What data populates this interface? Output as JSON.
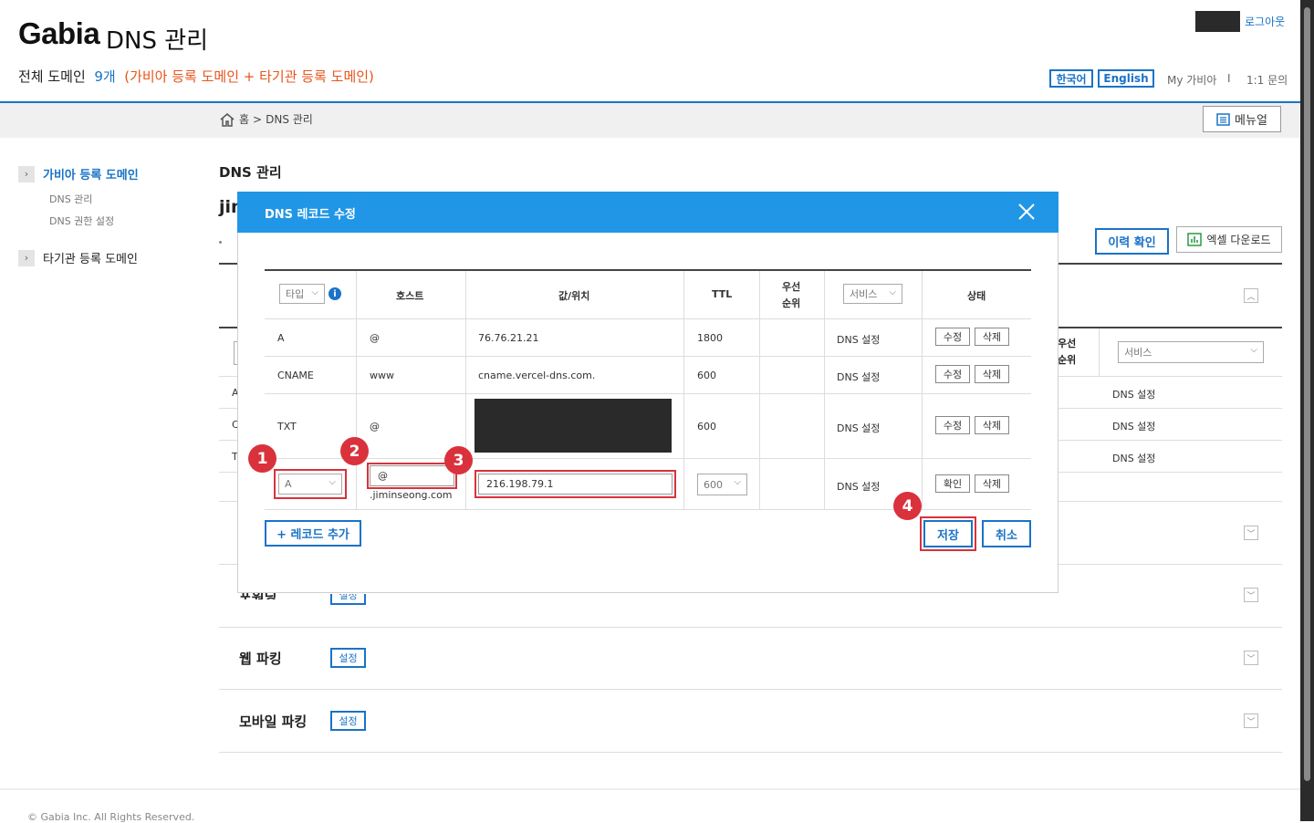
{
  "header": {
    "brand": "Gabia",
    "brand_sub": "DNS 관리",
    "domain_label": "전체 도메인",
    "domain_count": "9개",
    "domain_desc": "(가비아 등록 도메인 + 타기관 등록 도메인)",
    "logout": "로그아웃",
    "lang_ko": "한국어",
    "lang_en": "English",
    "my_gabia": "My 가비아",
    "separator": "I",
    "inquiry": "1:1 문의"
  },
  "breadcrumb": {
    "home": "홈",
    "sep": ">",
    "current": "DNS 관리"
  },
  "manual": "메뉴얼",
  "sidebar": {
    "group1": "가비아 등록 도메인",
    "items": [
      "DNS 관리",
      "DNS 권한 설정"
    ],
    "group2": "타기관 등록 도메인"
  },
  "main": {
    "title": "DNS 관리",
    "domain_partial": "jim",
    "history_btn": "이력 확인",
    "excel_btn": "엑셀 다운로드",
    "bg_priority": "우선\n순위",
    "bg_service": "서비스",
    "bg_rows": [
      "DNS 설정",
      "DNS 설정",
      "DNS 설정"
    ],
    "bg_types": [
      "A",
      "C",
      "T"
    ],
    "sections": [
      {
        "title": "포워딩",
        "btn": "설정"
      },
      {
        "title": "웹 파킹",
        "btn": "설정"
      },
      {
        "title": "모바일 파킹",
        "btn": "설정"
      }
    ]
  },
  "modal": {
    "title": "DNS 레코드 수정",
    "headers": {
      "type": "타입",
      "host": "호스트",
      "value": "값/위치",
      "ttl": "TTL",
      "priority": "우선\n순위",
      "service": "서비스",
      "status": "상태"
    },
    "rows": [
      {
        "type": "A",
        "host": "@",
        "value": "76.76.21.21",
        "ttl": "1800",
        "service": "DNS 설정",
        "edit": "수정",
        "delete": "삭제"
      },
      {
        "type": "CNAME",
        "host": "www",
        "value": "cname.vercel-dns.com.",
        "ttl": "600",
        "service": "DNS 설정",
        "edit": "수정",
        "delete": "삭제"
      },
      {
        "type": "TXT",
        "host": "@",
        "value": "",
        "ttl": "600",
        "service": "DNS 설정",
        "edit": "수정",
        "delete": "삭제"
      }
    ],
    "edit_row": {
      "type": "A",
      "host": "@",
      "host_suffix": ".jiminseong.com",
      "value": "216.198.79.1",
      "ttl": "600",
      "service": "DNS 설정",
      "confirm": "확인",
      "delete": "삭제"
    },
    "add_record": "+ 레코드 추가",
    "save": "저장",
    "cancel": "취소",
    "badges": [
      "1",
      "2",
      "3",
      "4"
    ]
  },
  "footer": "© Gabia Inc. All Rights Reserved.",
  "colors": {
    "accent": "#1a73c7",
    "modal_header": "#2196e6",
    "highlight": "#d9323c",
    "orange": "#e8541b"
  }
}
